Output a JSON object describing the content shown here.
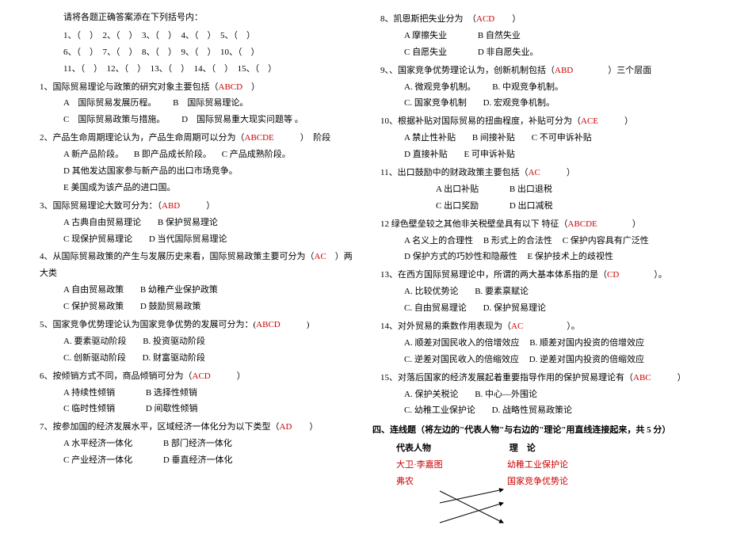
{
  "left": {
    "instruction": "请将各题正确答案添在下列括号内：",
    "slotsLine1": "1、（　）　2、（　）　3、（　）　4、（　）　5、（　）",
    "slotsLine2": "6、（　）　7、（　）　8、（　）　9、（　）　10、（　）",
    "slotsLine3": "11、（　）　12、（　）　13、（　）　14、（　）　15、（　）",
    "q1": {
      "text": "1、国际贸易理论与政策的研究对象主要包括（",
      "ans": "ABCD",
      "tail": "　）",
      "optA": "A　国际贸易发展历程。",
      "optB": "B　国际贸易理论。",
      "optC": "C　国际贸易政策与措施。",
      "optD": "D　国际贸易重大现实问题等 。"
    },
    "q2": {
      "text": "2、产品生命周期理论认为，产品生命周期可以分为（",
      "ans": "ABCDE",
      "tail": "　　　）　阶段",
      "optA": "A 新产品阶段。",
      "optB": "B 即产品成长阶段。",
      "optC": "C 产品成熟阶段。",
      "optD": "D 其他发达国家参与新产品的出口市场竞争。",
      "optE": "E 美国成为该产品的进口国。"
    },
    "q3": {
      "text": "3、国际贸易理论大致可分为：（",
      "ans": "ABD",
      "tail": "　　　）",
      "optA": "A 古典自由贸易理论",
      "optB": "B 保护贸易理论",
      "optC": "C 现保护贸易理论",
      "optD": "D 当代国际贸易理论"
    },
    "q4": {
      "text": "4、从国际贸易政策的产生与发展历史来看，国际贸易政策主要可分为（",
      "ans": "AC",
      "tail": "　）两大类",
      "optA": "A 自由贸易政策",
      "optB": "B 幼稚产业保护政策",
      "optC": "C 保护贸易政策",
      "optD": "D 鼓励贸易政策"
    },
    "q5": {
      "text": "5、国家竞争优势理论认为国家竞争优势的发展可分为：(",
      "ans": "ABCD",
      "tail": "　　　)",
      "optA": "A. 要素驱动阶段",
      "optB": "B. 投资驱动阶段",
      "optC": "C. 创新驱动阶段",
      "optD": "D. 财富驱动阶段"
    },
    "q6": {
      "text": "6、按倾销方式不同，商品倾销可分为（",
      "ans": "ACD",
      "tail": "　　　）",
      "optA": "A 持续性倾销",
      "optB": "B 选择性倾销",
      "optC": "C 临时性倾销",
      "optD": "D 间歇性倾销"
    },
    "q7": {
      "text": "7、按参加国的经济发展水平，区域经济一体化分为以下类型（",
      "ans": "AD",
      "tail": "　　）",
      "optA": "A 水平经济一体化",
      "optB": "B 部门经济一体化",
      "optC": "C 产业经济一体化",
      "optD": "D 垂直经济一体化"
    }
  },
  "right": {
    "q8": {
      "text": "8、凯恩斯把失业分为　（",
      "ans": "ACD",
      "tail": "　　）",
      "optA": "A 摩擦失业",
      "optB": "B 自然失业",
      "optC": "C 自愿失业",
      "optD": "D 非自愿失业。"
    },
    "q9": {
      "text": "9、、国家竞争优势理论认为，创新机制包括（",
      "ans": "ABD",
      "tail": "　　　　）三个层面",
      "optA": "A. 微观竞争机制。",
      "optB": "B. 中观竞争机制。",
      "optC": "C. 国家竞争机制",
      "optD": "D. 宏观竞争机制。"
    },
    "q10": {
      "text": "10、根据补贴对国际贸易的扭曲程度，补贴可分为（",
      "ans": "ACE",
      "tail": "　　　）",
      "optA": "A 禁止性补贴",
      "optB": "B 间接补贴",
      "optC": "C 不可申诉补贴",
      "optD": "D 直接补贴",
      "optE": "E 可申诉补贴"
    },
    "q11": {
      "text": "11、出口鼓励中的财政政策主要包括（",
      "ans": "AC",
      "tail": "　　　）",
      "optA": "A 出口补贴",
      "optB": "B 出口退税",
      "optC": "C 出口奖励",
      "optD": "D 出口减税"
    },
    "q12": {
      "text": "12 绿色壁垒较之其他非关税壁垒具有以下 特征（",
      "ans": "ABCDE",
      "tail": "　　　　）",
      "optA": "A 名义上的合理性",
      "optB": "B 形式上的合法性",
      "optC": "C 保护内容具有广泛性",
      "optD": "D 保护方式的巧妙性和隐蔽性",
      "optE": "E 保护技术上的歧视性"
    },
    "q13": {
      "text": "13、在西方国际贸易理论中，所谓的两大基本体系指的是（",
      "ans": "CD",
      "tail": "　　　　）。",
      "optA": "A. 比较优势论",
      "optB": "B. 要素禀赋论",
      "optC": "C. 自由贸易理论",
      "optD": "D. 保护贸易理论"
    },
    "q14": {
      "text": "14、对外贸易的乘数作用表现为（",
      "ans": "AC",
      "tail": "　　　　　）。",
      "optA": "A. 顺差对国民收入的倍增效应",
      "optB": "B. 顺差对国内投资的倍增效应",
      "optC": "C. 逆差对国民收入的倍缩效应",
      "optD": "D. 逆差对国内投资的倍缩效应"
    },
    "q15": {
      "text": "15、对落后国家的经济发展起着重要指导作用的保护贸易理论有（",
      "ans": "ABC",
      "tail": "　　　）",
      "optA": "A. 保护关税论",
      "optB": "B. 中心—外围论",
      "optC": "C. 幼稚工业保护论",
      "optD": "D. 战略性贸易政策论"
    },
    "section4Title": "四、连线题（将左边的\"代表人物\"与右边的\"理论\"用直线连接起来，共 5 分）",
    "matchHeadL": "代表人物",
    "matchHeadR": "理　论",
    "matchL1": "大卫·李嘉图",
    "matchR1": "幼稚工业保护论",
    "matchL2": "弗农",
    "matchR2": "国家竞争优势论"
  }
}
